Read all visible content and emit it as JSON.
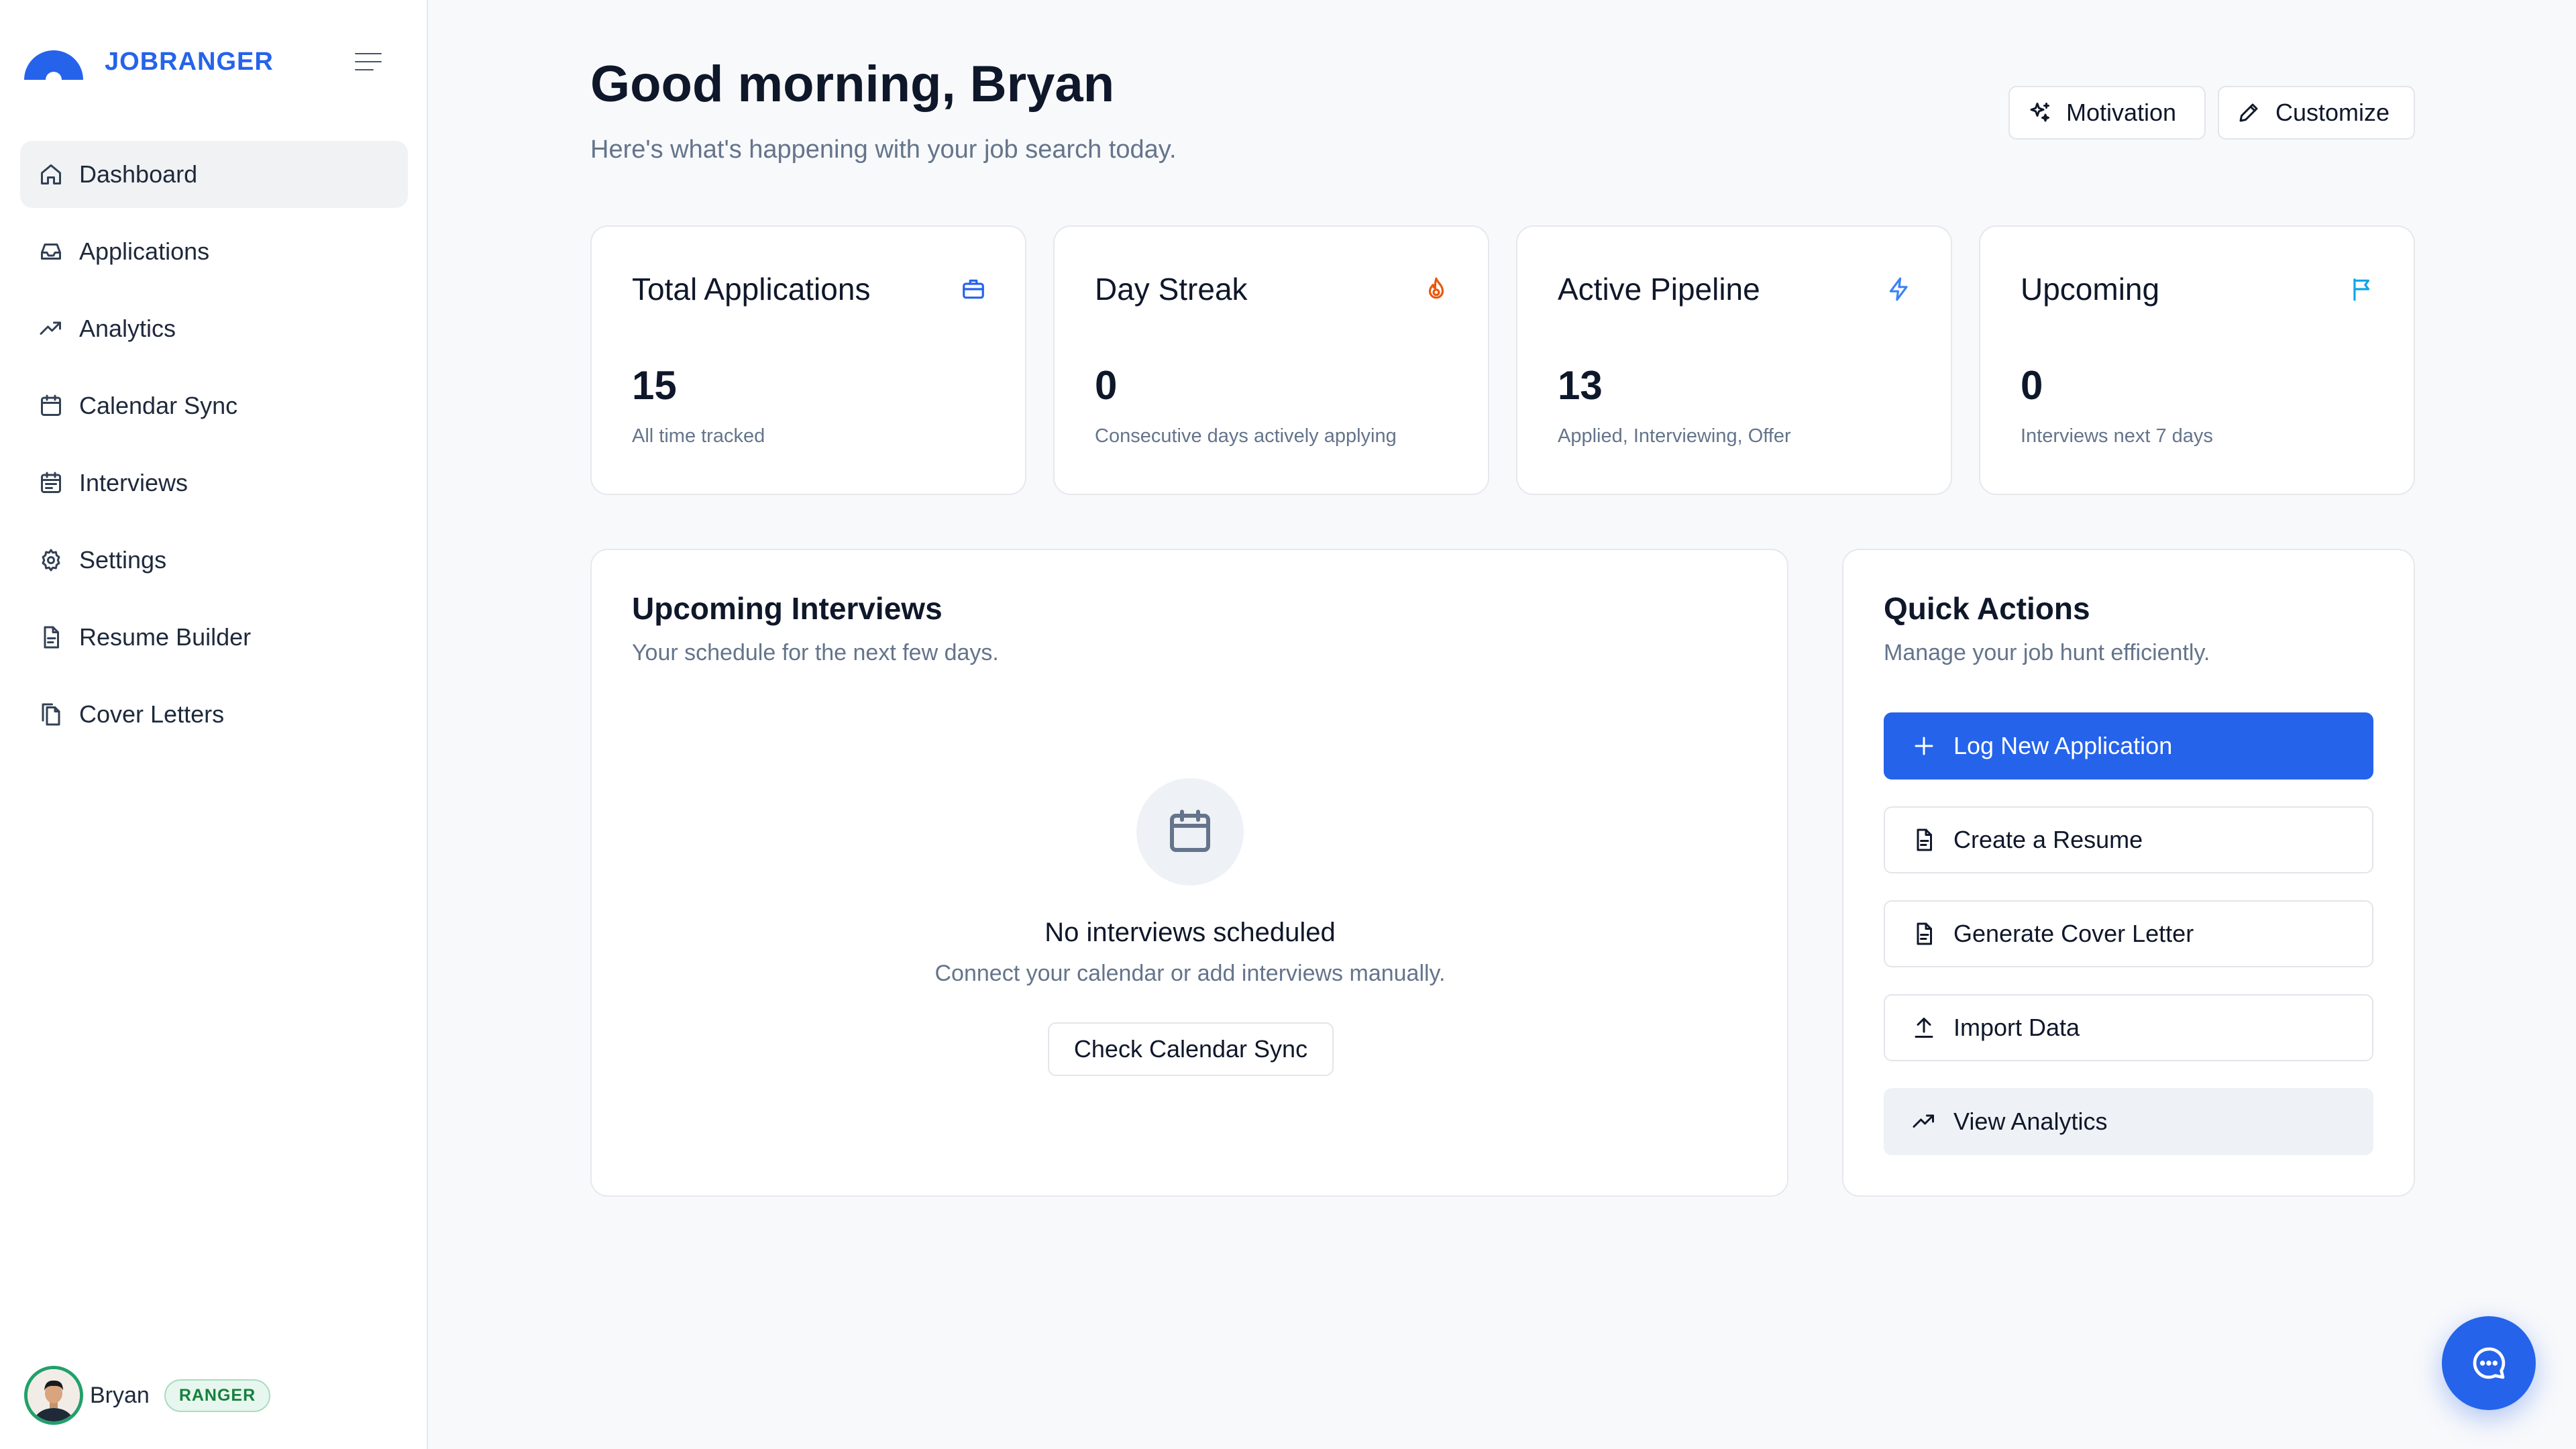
{
  "brand": {
    "name": "JOBRANGER"
  },
  "colors": {
    "accent": "#2563eb",
    "ranger_badge": "#15803d",
    "streak_icon": "#ea580c",
    "pipeline_icon": "#3b82f6",
    "upcoming_icon": "#0ea5e9"
  },
  "sidebar": {
    "items": [
      {
        "label": "Dashboard",
        "icon": "home-icon",
        "active": true
      },
      {
        "label": "Applications",
        "icon": "inbox-icon"
      },
      {
        "label": "Analytics",
        "icon": "trending-up-icon"
      },
      {
        "label": "Calendar Sync",
        "icon": "calendar-icon"
      },
      {
        "label": "Interviews",
        "icon": "calendar-list-icon"
      },
      {
        "label": "Settings",
        "icon": "gear-icon"
      },
      {
        "label": "Resume Builder",
        "icon": "document-icon"
      },
      {
        "label": "Cover Letters",
        "icon": "documents-icon"
      }
    ],
    "user": {
      "name": "Bryan",
      "badge": "RANGER"
    }
  },
  "header": {
    "greeting": "Good morning, Bryan",
    "subtitle": "Here's what's happening with your job search today.",
    "motivation_label": "Motivation",
    "customize_label": "Customize"
  },
  "stats": [
    {
      "title": "Total Applications",
      "value": "15",
      "desc": "All time tracked",
      "icon": "briefcase-icon"
    },
    {
      "title": "Day Streak",
      "value": "0",
      "desc": "Consecutive days actively applying",
      "icon": "flame-icon"
    },
    {
      "title": "Active Pipeline",
      "value": "13",
      "desc": "Applied, Interviewing, Offer",
      "icon": "lightning-icon"
    },
    {
      "title": "Upcoming",
      "value": "0",
      "desc": "Interviews next 7 days",
      "icon": "flag-icon"
    }
  ],
  "interviews": {
    "title": "Upcoming Interviews",
    "subtitle": "Your schedule for the next few days.",
    "empty_title": "No interviews scheduled",
    "empty_sub": "Connect your calendar or add interviews manually.",
    "button": "Check Calendar Sync"
  },
  "quick_actions": {
    "title": "Quick Actions",
    "subtitle": "Manage your job hunt efficiently.",
    "buttons": [
      {
        "label": "Log New Application",
        "icon": "plus-icon"
      },
      {
        "label": "Create a Resume",
        "icon": "document-icon"
      },
      {
        "label": "Generate Cover Letter",
        "icon": "document-icon"
      },
      {
        "label": "Import Data",
        "icon": "upload-icon"
      },
      {
        "label": "View Analytics",
        "icon": "trending-up-icon"
      }
    ]
  }
}
